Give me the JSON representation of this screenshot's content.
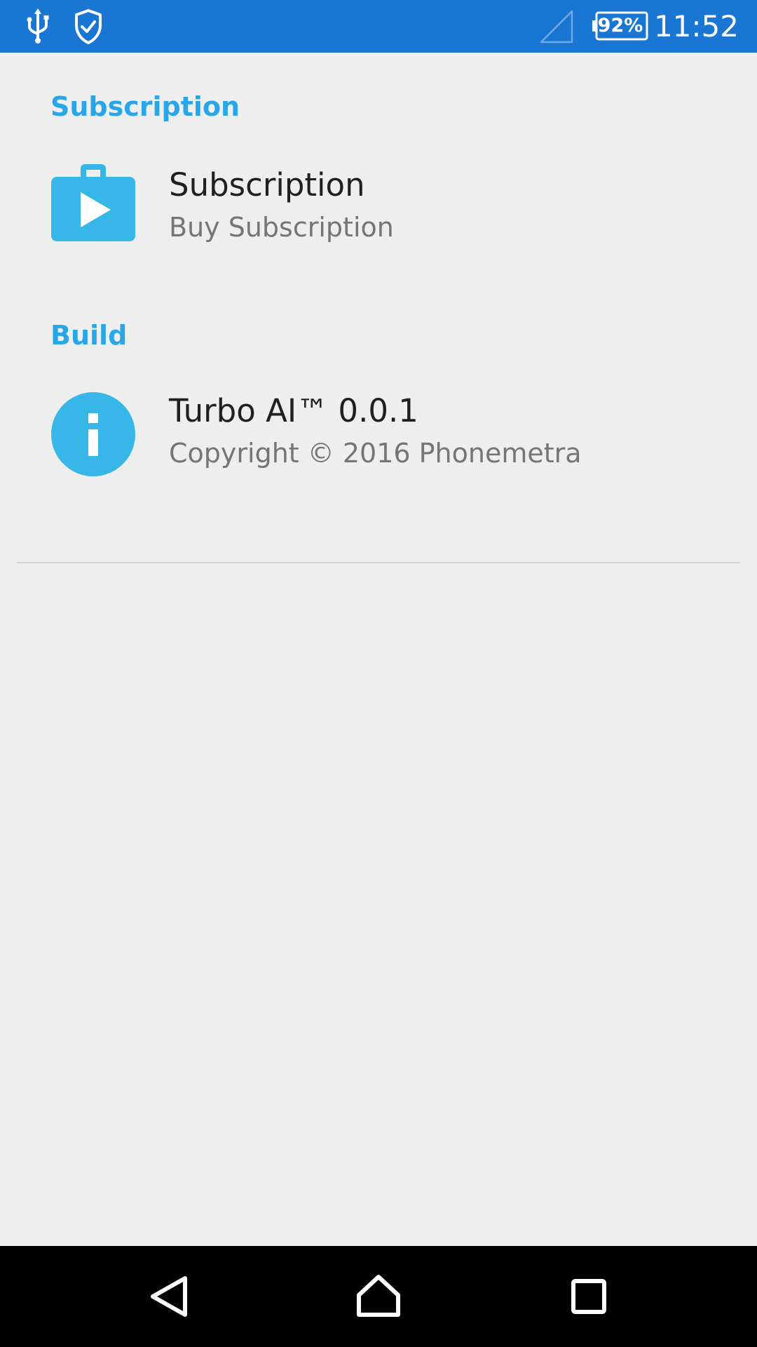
{
  "status_bar": {
    "battery_percent": "92%",
    "time": "11:52",
    "icons": [
      "usb-icon",
      "shield-check-icon",
      "signal-icon",
      "battery-icon"
    ]
  },
  "sections": [
    {
      "header": "Subscription",
      "item": {
        "title": "Subscription",
        "summary": "Buy Subscription",
        "icon": "play-store-bag-icon"
      }
    },
    {
      "header": "Build",
      "item": {
        "title": "Turbo AI™ 0.0.1",
        "summary": "Copyright © 2016 Phonemetra",
        "icon": "info-icon"
      }
    }
  ],
  "nav_bar": {
    "icons": [
      "back-icon",
      "home-icon",
      "recents-icon"
    ]
  },
  "colors": {
    "status_bar": "#1976d2",
    "accent": "#29a6e8",
    "icon_fill": "#36b7e8",
    "background": "#eeeeee",
    "nav_bar": "#000000"
  }
}
